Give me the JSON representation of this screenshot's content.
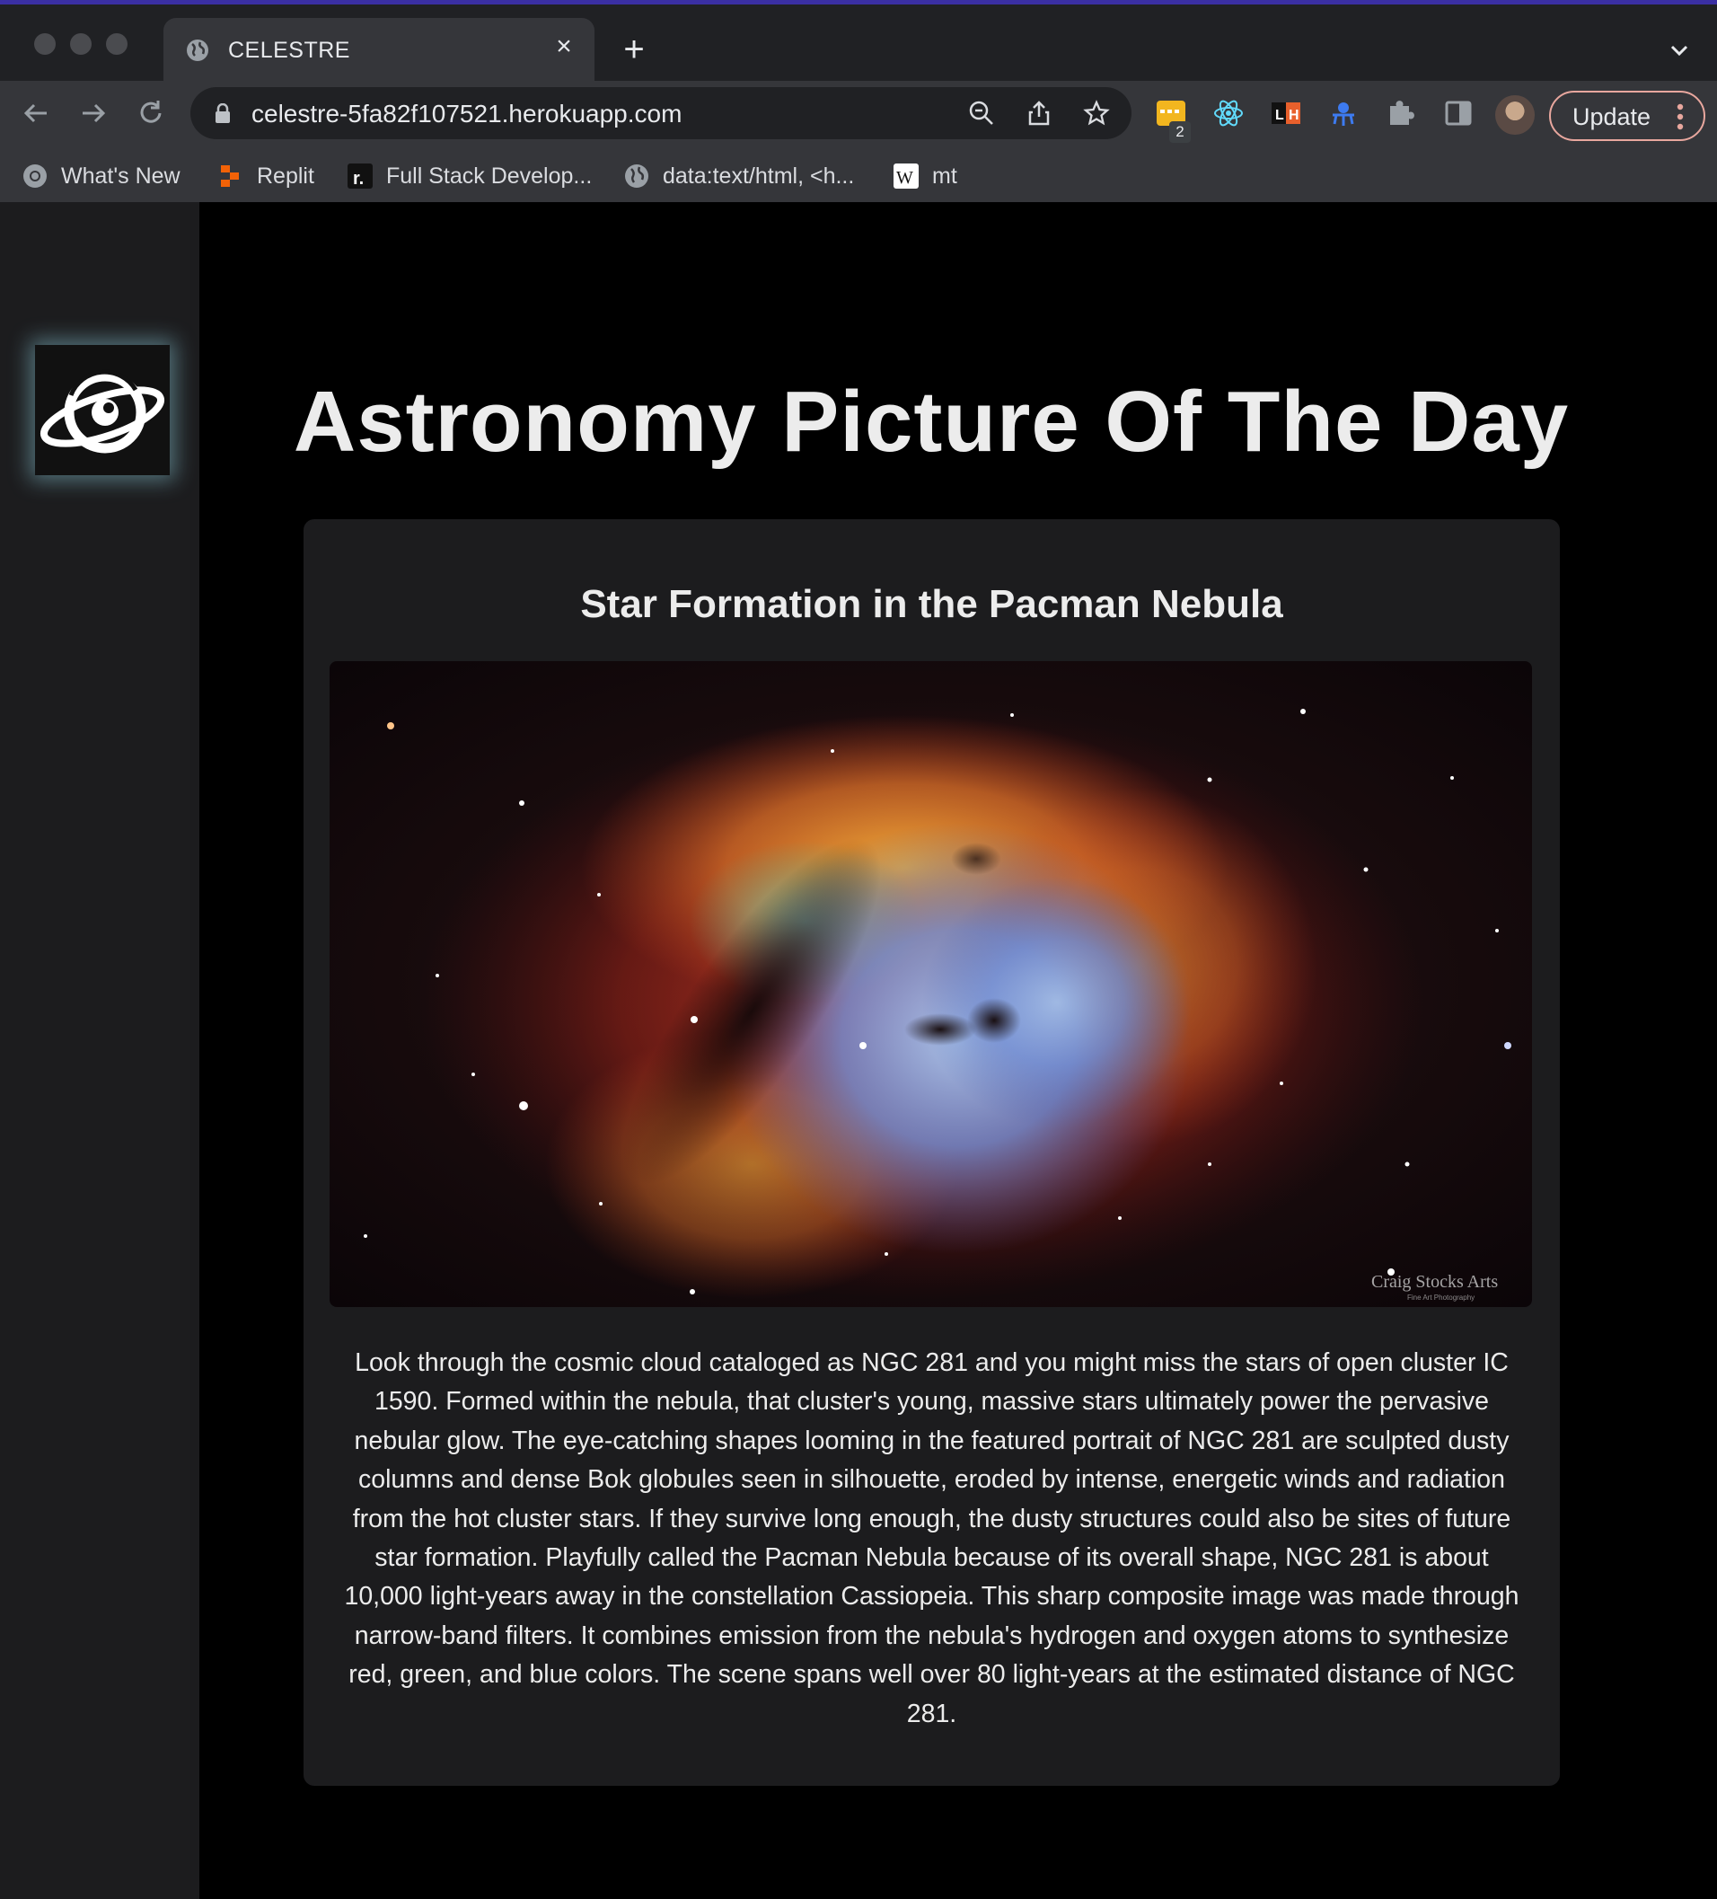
{
  "browser": {
    "tab": {
      "title": "CELESTRE",
      "icon": "globe-icon"
    },
    "address_bar": {
      "url": "celestre-5fa82f107521.herokuapp.com"
    },
    "extensions": [
      {
        "name": "extension-yellow-icon",
        "badge": "2"
      },
      {
        "name": "react-devtools-icon"
      },
      {
        "name": "lighthouse-icon"
      },
      {
        "name": "extension-blue-icon"
      },
      {
        "name": "puzzle-icon"
      }
    ],
    "update_button": {
      "label": "Update"
    },
    "bookmarks": [
      {
        "label": "What's New",
        "icon": "chrome-icon"
      },
      {
        "label": "Replit",
        "icon": "replit-icon"
      },
      {
        "label": "Full Stack Develop...",
        "icon": "fullstack-icon"
      },
      {
        "label": "data:text/html, <h...",
        "icon": "globe-icon"
      },
      {
        "label": "mt",
        "icon": "wikipedia-icon"
      }
    ]
  },
  "page": {
    "logo": {
      "icon": "planet-logo-icon"
    },
    "title": "Astronomy Picture Of The Day",
    "apod": {
      "title": "Star Formation in the Pacman Nebula",
      "image_credit": "Craig Stocks Arts",
      "image_credit_sub": "Fine Art Photography",
      "explanation": "Look through the cosmic cloud cataloged as NGC 281 and you might miss the stars of open cluster IC 1590. Formed within the nebula, that cluster's young, massive stars ultimately power the pervasive nebular glow. The eye-catching shapes looming in the featured portrait of NGC 281 are sculpted dusty columns and dense Bok globules seen in silhouette, eroded by intense, energetic winds and radiation from the hot cluster stars. If they survive long enough, the dusty structures could also be sites of future star formation. Playfully called the Pacman Nebula because of its overall shape, NGC 281 is about 10,000 light-years away in the constellation Cassiopeia. This sharp composite image was made through narrow-band filters. It combines emission from the nebula's hydrogen and oxygen atoms to synthesize red, green, and blue colors. The scene spans well over 80 light-years at the estimated distance of NGC 281."
    }
  },
  "colors": {
    "page_background": "#000000",
    "sidebar_background": "#1c1c1e",
    "card_background": "#1c1c1e",
    "text": "#ececec",
    "update_border": "#e8a79e"
  }
}
